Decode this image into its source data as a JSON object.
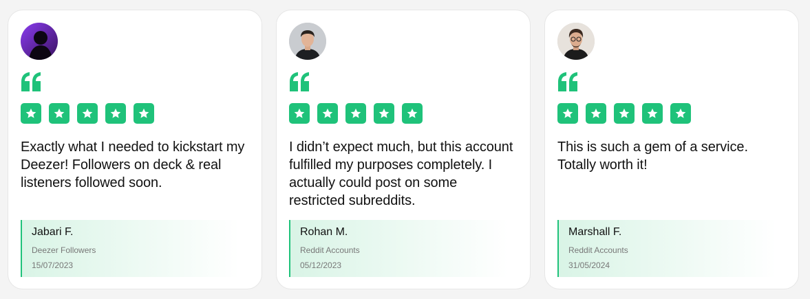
{
  "colors": {
    "accent": "#1fc27a",
    "author_bg_start": "#d9f4e6",
    "author_bg_end": "#ffffff",
    "text": "#111111",
    "muted": "#777777"
  },
  "testimonials": [
    {
      "avatar_icon": "avatar-purple-silhouette",
      "rating": 5,
      "text": "Exactly what I needed to kickstart my Deezer! Followers on deck & real listeners followed soon.",
      "name": "Jabari F.",
      "product": "Deezer Followers",
      "date": "15/07/2023"
    },
    {
      "avatar_icon": "avatar-man-portrait",
      "rating": 5,
      "text": "I didn’t expect much, but this account fulfilled my purposes completely. I actually could post on some restricted subreddits.",
      "name": "Rohan M.",
      "product": "Reddit Accounts",
      "date": "05/12/2023"
    },
    {
      "avatar_icon": "avatar-man-glasses-portrait",
      "rating": 5,
      "text": "This is such a gem of a service. Totally worth it!",
      "name": "Marshall F.",
      "product": "Reddit Accounts",
      "date": "31/05/2024"
    }
  ]
}
